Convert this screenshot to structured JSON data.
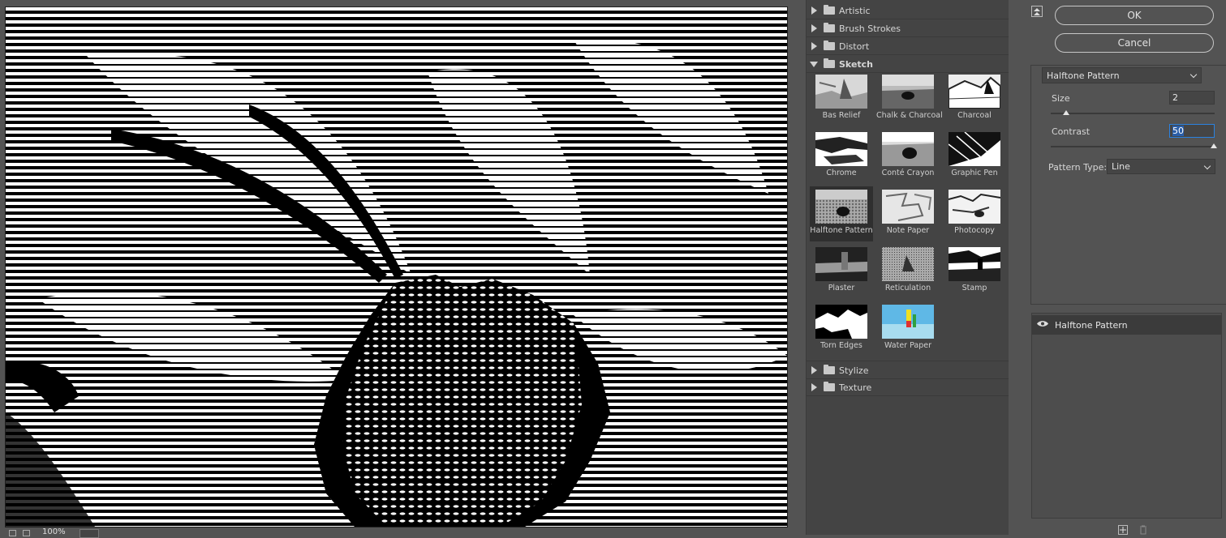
{
  "gallery": {
    "categories_top": [
      {
        "label": "Artistic"
      },
      {
        "label": "Brush Strokes"
      },
      {
        "label": "Distort"
      },
      {
        "label": "Sketch",
        "expanded": true
      }
    ],
    "thumbnails": [
      {
        "label": "Bas Relief"
      },
      {
        "label": "Chalk & Charcoal"
      },
      {
        "label": "Charcoal"
      },
      {
        "label": "Chrome"
      },
      {
        "label": "Conté Crayon"
      },
      {
        "label": "Graphic Pen"
      },
      {
        "label": "Halftone Pattern",
        "selected": true
      },
      {
        "label": "Note Paper"
      },
      {
        "label": "Photocopy"
      },
      {
        "label": "Plaster"
      },
      {
        "label": "Reticulation"
      },
      {
        "label": "Stamp"
      },
      {
        "label": "Torn Edges"
      },
      {
        "label": "Water Paper"
      }
    ],
    "categories_bottom": [
      {
        "label": "Stylize"
      },
      {
        "label": "Texture"
      }
    ]
  },
  "buttons": {
    "ok": "OK",
    "cancel": "Cancel"
  },
  "settings": {
    "filter_name": "Halftone Pattern",
    "size_label": "Size",
    "size_value": "2",
    "contrast_label": "Contrast",
    "contrast_value": "50",
    "pattern_type_label": "Pattern Type:",
    "pattern_type_value": "Line"
  },
  "layers": {
    "items": [
      {
        "name": "Halftone Pattern",
        "visible": true
      }
    ]
  },
  "preview": {
    "zoom": "100%"
  },
  "colors": {
    "selection": "#2b82e0",
    "panel": "#535353",
    "gallery": "#444444"
  }
}
